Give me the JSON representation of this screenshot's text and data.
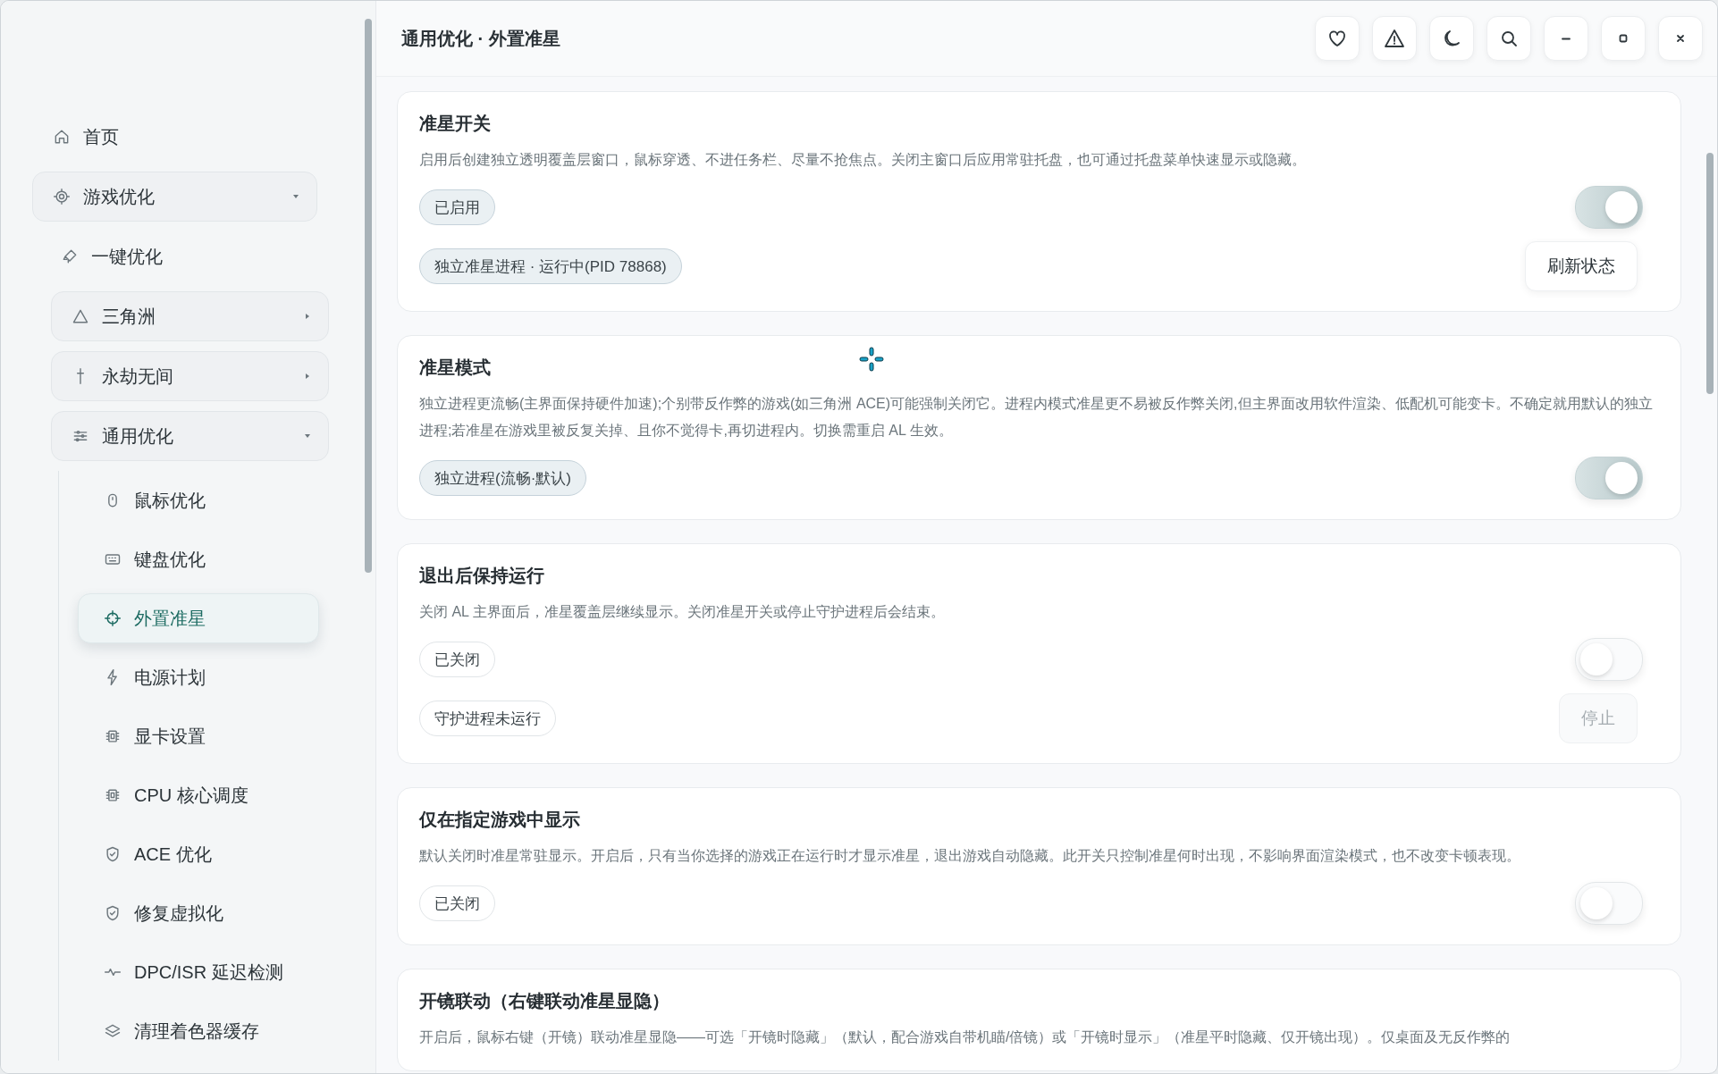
{
  "window": {
    "title": "通用优化 · 外置准星"
  },
  "sidebar": {
    "items": [
      {
        "label": "首页",
        "selected": false
      },
      {
        "label": "游戏优化",
        "selected": false,
        "expanded": true,
        "children": [
          {
            "label": "一键优化",
            "selected": false
          },
          {
            "label": "三角洲",
            "selected": false,
            "expanded": false
          },
          {
            "label": "永劫无间",
            "selected": false,
            "expanded": false
          },
          {
            "label": "通用优化",
            "selected": false,
            "expanded": true,
            "children": [
              {
                "label": "鼠标优化",
                "selected": false
              },
              {
                "label": "键盘优化",
                "selected": false
              },
              {
                "label": "外置准星",
                "selected": true
              },
              {
                "label": "电源计划",
                "selected": false
              },
              {
                "label": "显卡设置",
                "selected": false
              },
              {
                "label": "CPU 核心调度",
                "selected": false
              },
              {
                "label": "ACE 优化",
                "selected": false
              },
              {
                "label": "修复虚拟化",
                "selected": false
              },
              {
                "label": "DPC/ISR 延迟检测",
                "selected": false
              },
              {
                "label": "清理着色器缓存",
                "selected": false
              }
            ]
          }
        ]
      }
    ]
  },
  "cards": [
    {
      "title": "准星开关",
      "description": "启用后创建独立透明覆盖层窗口，鼠标穿透、不进任务栏、尽量不抢焦点。关闭主窗口后应用常驻托盘，也可通过托盘菜单快速显示或隐藏。",
      "rows": [
        {
          "kind": "toggle",
          "chip": {
            "label": "已启用",
            "active": true
          },
          "on": true
        },
        {
          "kind": "action",
          "chip": {
            "label": "独立准星进程 · 运行中(PID 78868)",
            "active": true
          },
          "button": {
            "label": "刷新状态",
            "disabled": false
          }
        }
      ]
    },
    {
      "title": "准星模式",
      "description": "独立进程更流畅(主界面保持硬件加速);个别带反作弊的游戏(如三角洲 ACE)可能强制关闭它。进程内模式准星更不易被反作弊关闭,但主界面改用软件渲染、低配机可能变卡。不确定就用默认的独立进程;若准星在游戏里被反复关掉、且你不觉得卡,再切进程内。切换需重启 AL 生效。",
      "rows": [
        {
          "kind": "toggle",
          "chip": {
            "label": "独立进程(流畅·默认)",
            "active": true
          },
          "on": true
        }
      ]
    },
    {
      "title": "退出后保持运行",
      "description": "关闭 AL 主界面后，准星覆盖层继续显示。关闭准星开关或停止守护进程后会结束。",
      "rows": [
        {
          "kind": "toggle",
          "chip": {
            "label": "已关闭",
            "active": false
          },
          "on": false
        },
        {
          "kind": "action",
          "chip": {
            "label": "守护进程未运行",
            "active": false
          },
          "button": {
            "label": "停止",
            "disabled": true
          }
        }
      ]
    },
    {
      "title": "仅在指定游戏中显示",
      "description": "默认关闭时准星常驻显示。开启后，只有当你选择的游戏正在运行时才显示准星，退出游戏自动隐藏。此开关只控制准星何时出现，不影响界面渲染模式，也不改变卡顿表现。",
      "rows": [
        {
          "kind": "toggle",
          "chip": {
            "label": "已关闭",
            "active": false
          },
          "on": false
        }
      ]
    },
    {
      "title": "开镜联动（右键联动准星显隐）",
      "description": "开启后，鼠标右键（开镜）联动准星显隐——可选「开镜时隐藏」（默认，配合游戏自带机瞄/倍镜）或「开镜时显示」（准星平时隐藏、仅开镜出现）。仅桌面及无反作弊的"
    }
  ]
}
